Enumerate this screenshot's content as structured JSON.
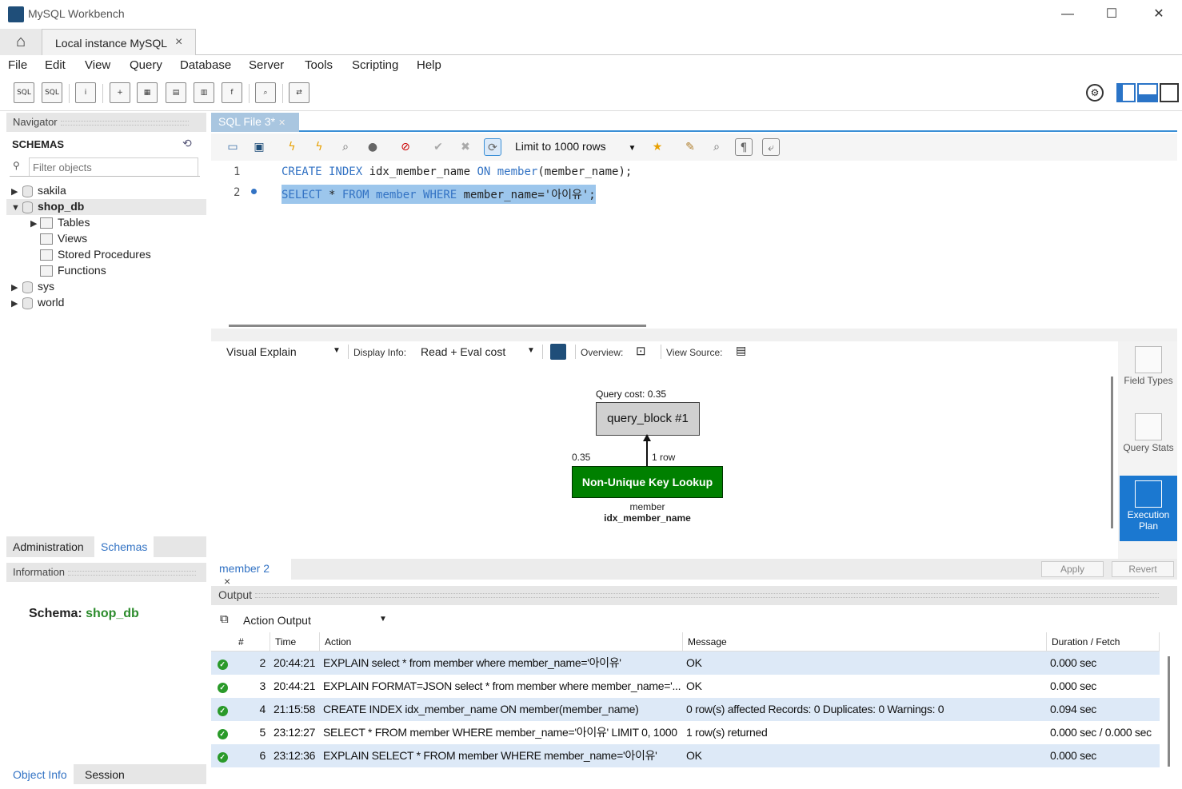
{
  "window": {
    "title": "MySQL Workbench",
    "min": "—",
    "max": "☐",
    "close": "✕"
  },
  "tabs": {
    "home": "⌂",
    "connection": "Local instance MySQL",
    "close": "×"
  },
  "menu": [
    "File",
    "Edit",
    "View",
    "Query",
    "Database",
    "Server",
    "Tools",
    "Scripting",
    "Help"
  ],
  "navigator": {
    "header": "Navigator",
    "schemas_title": "SCHEMAS",
    "filter_placeholder": "Filter objects",
    "tree": [
      {
        "name": "sakila",
        "expanded": false
      },
      {
        "name": "shop_db",
        "expanded": true,
        "children": [
          "Tables",
          "Views",
          "Stored Procedures",
          "Functions"
        ]
      },
      {
        "name": "sys",
        "expanded": false
      },
      {
        "name": "world",
        "expanded": false
      }
    ],
    "bottom_tabs": [
      "Administration",
      "Schemas"
    ],
    "info_header": "Information",
    "schema_label": "Schema:",
    "schema_value": "shop_db",
    "info_tabs": [
      "Object Info",
      "Session"
    ]
  },
  "editor": {
    "tab": "SQL File 3*",
    "limit": "Limit to 1000 rows",
    "lines": [
      {
        "num": "1",
        "parts": [
          [
            "kw",
            "CREATE INDEX "
          ],
          [
            "",
            "idx_member_name "
          ],
          [
            "kw",
            "ON "
          ],
          [
            "kw",
            "member"
          ],
          [
            "",
            "(member_name);"
          ]
        ]
      },
      {
        "num": "2",
        "parts": [
          [
            "kw",
            "SELECT "
          ],
          [
            "",
            "* "
          ],
          [
            "kw",
            "FROM "
          ],
          [
            "kw",
            "member "
          ],
          [
            "kw",
            "WHERE "
          ],
          [
            "",
            "member_name="
          ],
          [
            "",
            "'아이유';"
          ]
        ]
      }
    ]
  },
  "explain": {
    "view": "Visual Explain",
    "display_info_label": "Display Info:",
    "display_info_value": "Read + Eval cost",
    "overview_label": "Overview:",
    "view_source_label": "View Source:",
    "query_cost": "Query cost: 0.35",
    "query_block": "query_block #1",
    "cost": "0.35",
    "rows": "1 row",
    "lookup": "Non-Unique Key Lookup",
    "table": "member",
    "index": "idx_member_name"
  },
  "side_buttons": [
    "Field Types",
    "Query Stats",
    "Execution Plan"
  ],
  "result_tab": {
    "label": "member 2",
    "close": "×",
    "apply": "Apply",
    "revert": "Revert"
  },
  "output": {
    "header": "Output",
    "selector": "Action Output",
    "columns": [
      "#",
      "Time",
      "Action",
      "Message",
      "Duration / Fetch"
    ],
    "rows": [
      {
        "num": "2",
        "time": "20:44:21",
        "action": "EXPLAIN select * from member where member_name='아이유'",
        "message": "OK",
        "duration": "0.000 sec"
      },
      {
        "num": "3",
        "time": "20:44:21",
        "action": "EXPLAIN FORMAT=JSON select * from member where member_name='...",
        "message": "OK",
        "duration": "0.000 sec"
      },
      {
        "num": "4",
        "time": "21:15:58",
        "action": "CREATE INDEX idx_member_name ON member(member_name)",
        "message": "0 row(s) affected Records: 0  Duplicates: 0  Warnings: 0",
        "duration": "0.094 sec"
      },
      {
        "num": "5",
        "time": "23:12:27",
        "action": "SELECT * FROM member WHERE member_name='아이유' LIMIT 0, 1000",
        "message": "1 row(s) returned",
        "duration": "0.000 sec / 0.000 sec"
      },
      {
        "num": "6",
        "time": "23:12:36",
        "action": "EXPLAIN SELECT * FROM member WHERE member_name='아이유'",
        "message": "OK",
        "duration": "0.000 sec"
      }
    ]
  }
}
